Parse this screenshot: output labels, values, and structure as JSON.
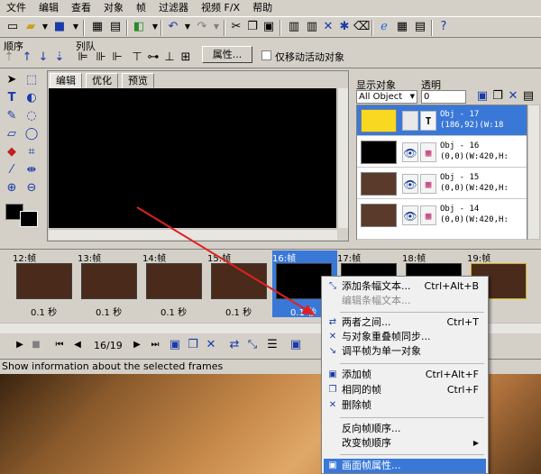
{
  "menubar": [
    "文件",
    "编辑",
    "查看",
    "对象",
    "帧",
    "过滤器",
    "视频 F/X",
    "帮助"
  ],
  "toolbar": {
    "order_label": "顺序",
    "queue_label": "列队",
    "properties_button": "属性...",
    "move_active_only": "仅移动活动对象"
  },
  "tabs": [
    "编辑",
    "优化",
    "预览"
  ],
  "right_panel": {
    "show_objects_label": "显示对象",
    "opacity_label": "透明",
    "objects_filter": "All Object",
    "opacity_value": "0"
  },
  "objects": [
    {
      "text": "Obj - 17\n(186,92)(W:18",
      "type": "T",
      "selected": true
    },
    {
      "text": "Obj - 16\n(0,0)(W:420,H:",
      "type": "img",
      "selected": false
    },
    {
      "text": "Obj - 15\n(0,0)(W:420,H:",
      "type": "img",
      "selected": false
    },
    {
      "text": "Obj - 14\n(0,0)(W:420,H:",
      "type": "img",
      "selected": false
    }
  ],
  "frames": [
    {
      "label": "12:帧",
      "duration": "0.1 秒"
    },
    {
      "label": "13:帧",
      "duration": "0.1 秒"
    },
    {
      "label": "14:帧",
      "duration": "0.1 秒"
    },
    {
      "label": "15:帧",
      "duration": "0.1 秒"
    },
    {
      "label": "16:帧",
      "duration": "0.1 秒"
    },
    {
      "label": "17:帧",
      "duration": ""
    },
    {
      "label": "18:帧",
      "duration": ""
    },
    {
      "label": "19:帧",
      "duration": ""
    }
  ],
  "playback": {
    "frame_counter": "16/19"
  },
  "status": "Show information about the selected frames",
  "context_menu": [
    {
      "label": "添加条幅文本...",
      "shortcut": "Ctrl+Alt+B",
      "icon": "banner-text-icon",
      "disabled": false
    },
    {
      "label": "编辑条幅文本...",
      "shortcut": "",
      "icon": "",
      "disabled": true
    },
    {
      "label": "两者之间...",
      "shortcut": "Ctrl+T",
      "icon": "tween-icon",
      "disabled": false
    },
    {
      "label": "与对象重叠帧同步...",
      "shortcut": "",
      "icon": "sync-icon",
      "disabled": false
    },
    {
      "label": "调平帧为单一对象",
      "shortcut": "",
      "icon": "flatten-icon",
      "disabled": false
    },
    {
      "label": "添加帧",
      "shortcut": "Ctrl+Alt+F",
      "icon": "add-frame-icon",
      "disabled": false
    },
    {
      "label": "相同的帧",
      "shortcut": "Ctrl+F",
      "icon": "duplicate-frame-icon",
      "disabled": false
    },
    {
      "label": "删除帧",
      "shortcut": "",
      "icon": "delete-frame-icon",
      "disabled": false
    },
    {
      "label": "反向帧顺序...",
      "shortcut": "",
      "icon": "",
      "disabled": false
    },
    {
      "label": "改变帧顺序",
      "shortcut": "",
      "icon": "",
      "disabled": false,
      "submenu": true
    },
    {
      "label": "画面帧属性...",
      "shortcut": "",
      "icon": "frame-properties-icon",
      "disabled": false,
      "highlighted": true
    }
  ],
  "colors": {
    "selection": "#3a78d8",
    "arrow": "#e02020"
  }
}
